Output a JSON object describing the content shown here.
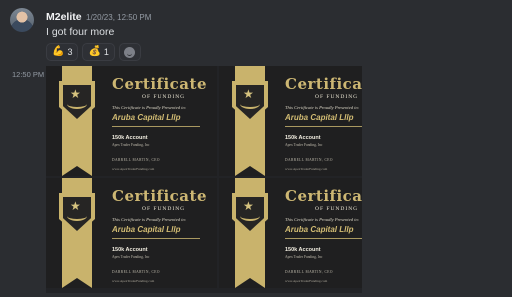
{
  "message": {
    "username": "M2elite",
    "timestamp": "1/20/23, 12:50 PM",
    "content": "I got four more",
    "side_timestamp": "12:50 PM"
  },
  "reactions": [
    {
      "emoji": "💪",
      "icon": "flexed-biceps-icon",
      "count": "3"
    },
    {
      "emoji": "💰",
      "icon": "money-bag-icon",
      "count": "1"
    }
  ],
  "add_reaction_icon": "add-reaction-icon",
  "certificate": {
    "title": "Certificate",
    "subtitle": "OF FUNDING",
    "presented": "This Certificate is Proudly Presented to:",
    "recipient": "Aruba Capital Lllp",
    "account": "150k Account",
    "firm": "Apex Trader Funding, Inc",
    "signer": "DARRELL MARTIN, CEO",
    "url": "www.ApexTraderFunding.com"
  },
  "colors": {
    "gold": "#c9b36c",
    "background": "#2b2d31",
    "certificate_bg": "#1f1f20"
  }
}
